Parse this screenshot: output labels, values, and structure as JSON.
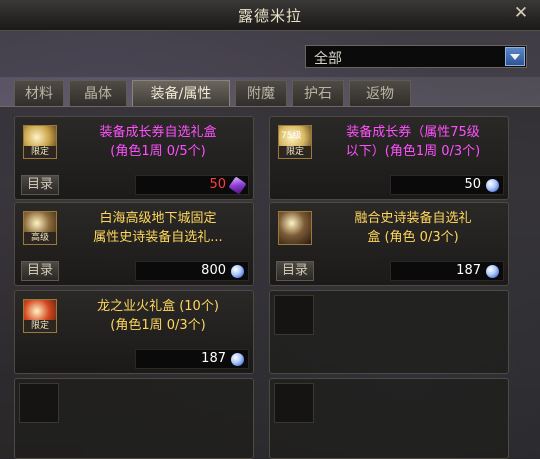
{
  "window": {
    "title": "露德米拉"
  },
  "filter": {
    "selected": "全部"
  },
  "tabs": [
    {
      "label": "材料",
      "active": false
    },
    {
      "label": "晶体",
      "active": false
    },
    {
      "label": "装备/属性",
      "active": true
    },
    {
      "label": "附魔",
      "active": false
    },
    {
      "label": "护石",
      "active": false
    },
    {
      "label": "返物",
      "active": false
    }
  ],
  "items": [
    {
      "line1": "装备成长券自选礼盒",
      "line2": "(角色1周 0/5个)",
      "color": "#ff50ff",
      "icon_tag": "限定",
      "icon_top": "",
      "icon_color": "#c9a24a",
      "button": "目录",
      "price": "50",
      "price_color": "#ff3b3b",
      "currency": "crystal-icon"
    },
    {
      "line1": "装备成长券（属性75级",
      "line2": "以下）(角色1周 0/3个)",
      "color": "#ff50ff",
      "icon_tag": "限定",
      "icon_top": "75级",
      "icon_color": "#d8b760",
      "button": "",
      "price": "50",
      "price_color": "#ffffff",
      "currency": "coin-icon"
    },
    {
      "line1": "白海高级地下城固定",
      "line2": "属性史诗装备自选礼...",
      "color": "#ffd75c",
      "icon_tag": "高级",
      "icon_top": "",
      "icon_color": "#8c6a3a",
      "button": "目录",
      "price": "800",
      "price_color": "#ffffff",
      "currency": "coin-icon"
    },
    {
      "line1": "融合史诗装备自选礼",
      "line2": "盒  (角色 0/3个)",
      "color": "#ffd75c",
      "icon_tag": "",
      "icon_top": "",
      "icon_color": "#7c5c36",
      "button": "目录",
      "price": "187",
      "price_color": "#ffffff",
      "currency": "coin-icon"
    },
    {
      "line1": "龙之业火礼盒 (10个)",
      "line2": "(角色1周 0/3个)",
      "color": "#ffd75c",
      "icon_tag": "限定",
      "icon_top": "",
      "icon_color": "#d2451e",
      "button": "",
      "price": "187",
      "price_color": "#ffffff",
      "currency": "coin-icon"
    }
  ]
}
